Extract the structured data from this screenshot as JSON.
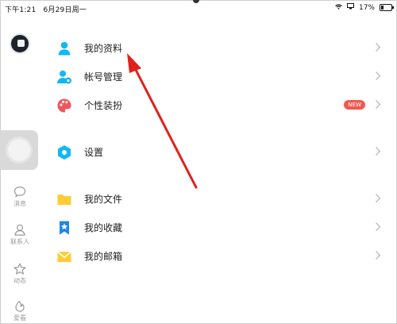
{
  "status_bar": {
    "time": "下午1:21",
    "date": "6月29日周一",
    "battery": "17%"
  },
  "left_rail": {
    "items": [
      {
        "label": "消息"
      },
      {
        "label": "联系人"
      },
      {
        "label": "动态"
      },
      {
        "label": "爱看"
      }
    ]
  },
  "menu": {
    "group1": [
      {
        "label": "我的资料",
        "icon": "person-icon"
      },
      {
        "label": "帐号管理",
        "icon": "account-manage-icon"
      },
      {
        "label": "个性装扮",
        "icon": "palette-icon",
        "badge": "NEW"
      }
    ],
    "group2": [
      {
        "label": "设置",
        "icon": "settings-hex-icon"
      }
    ],
    "group3": [
      {
        "label": "我的文件",
        "icon": "folder-icon"
      },
      {
        "label": "我的收藏",
        "icon": "bookmark-icon"
      },
      {
        "label": "我的邮箱",
        "icon": "mail-icon"
      }
    ]
  },
  "colors": {
    "accent_blue": "#12b7f5",
    "folder_yellow": "#ffcc33",
    "palette_red": "#f0575a",
    "badge_red": "#f05a4f",
    "annotation_arrow": "#e0201b"
  }
}
